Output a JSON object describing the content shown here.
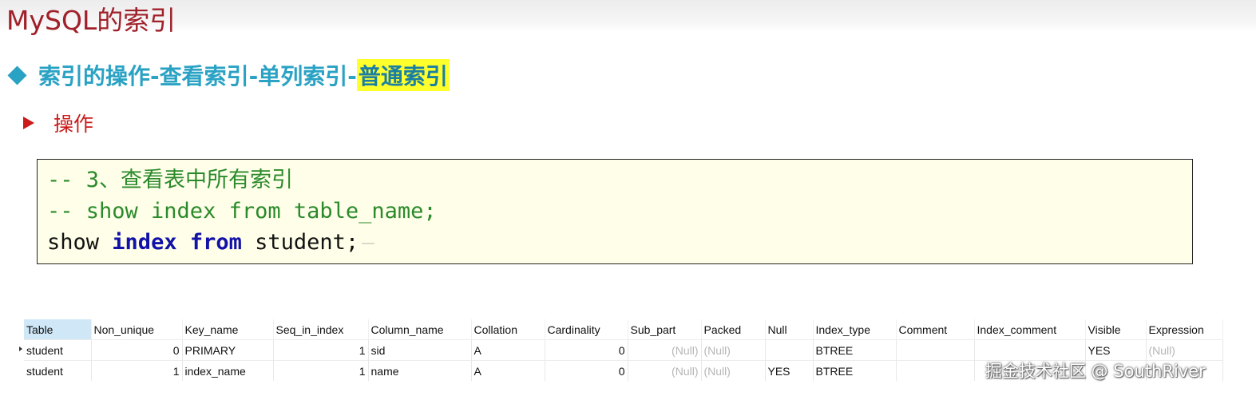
{
  "slide": {
    "title": "MySQL的索引",
    "subtitle_main": "索引的操作-查看索引-单列索引-",
    "subtitle_highlight": "普通索引",
    "operation_label": "操作",
    "colors": {
      "title": "#a0202a",
      "subtitle": "#2aa2c4",
      "highlight": "#ffff2c",
      "operation": "#cc1a1a"
    }
  },
  "code": {
    "line1": "-- 3、查看表中所有索引",
    "line2": "-- show index from table_name;",
    "line3_cmd": "show",
    "line3_kw1": "index",
    "line3_kw2": "from",
    "line3_rest": "student;"
  },
  "result": {
    "columns": [
      "Table",
      "Non_unique",
      "Key_name",
      "Seq_in_index",
      "Column_name",
      "Collation",
      "Cardinality",
      "Sub_part",
      "Packed",
      "Null",
      "Index_type",
      "Comment",
      "Index_comment",
      "Visible",
      "Expression"
    ],
    "rows": [
      [
        "student",
        "0",
        "PRIMARY",
        "1",
        "sid",
        "A",
        "0",
        "(Null)",
        "(Null)",
        "",
        "BTREE",
        "",
        "",
        "YES",
        "(Null)"
      ],
      [
        "student",
        "1",
        "index_name",
        "1",
        "name",
        "A",
        "0",
        "(Null)",
        "(Null)",
        "YES",
        "BTREE",
        "",
        "",
        "",
        ""
      ]
    ]
  },
  "watermark": "掘金技术社区 @ SouthRiver"
}
